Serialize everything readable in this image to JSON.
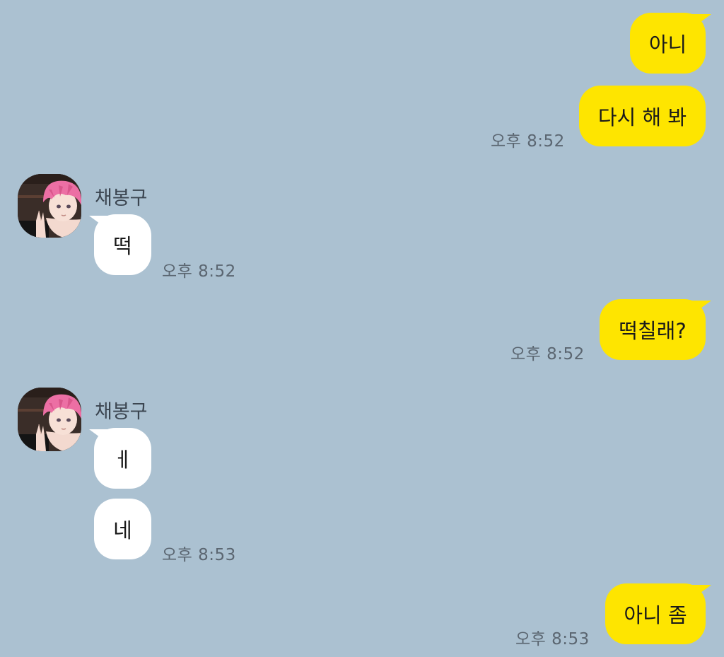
{
  "chat": {
    "sender_name": "채봉구",
    "messages": [
      {
        "id": "m1",
        "side": "me",
        "text": "아니"
      },
      {
        "id": "m2",
        "side": "me",
        "text": "다시 해 봐",
        "time": "오후 8:52"
      },
      {
        "id": "m3",
        "side": "them",
        "text": "떡",
        "time": "오후 8:52"
      },
      {
        "id": "m4",
        "side": "me",
        "text": "떡칠래?",
        "time": "오후 8:52"
      },
      {
        "id": "m5",
        "side": "them",
        "text": "ㅔ"
      },
      {
        "id": "m6",
        "side": "them",
        "text": "네",
        "time": "오후 8:53"
      },
      {
        "id": "m7",
        "side": "me",
        "text": "아니 좀",
        "time": "오후 8:53"
      }
    ]
  },
  "colors": {
    "background": "#abc1d1",
    "my_bubble": "#fee500",
    "their_bubble": "#ffffff"
  },
  "icons": {
    "avatar": "profile-avatar-pink-hair-peace-sign"
  }
}
